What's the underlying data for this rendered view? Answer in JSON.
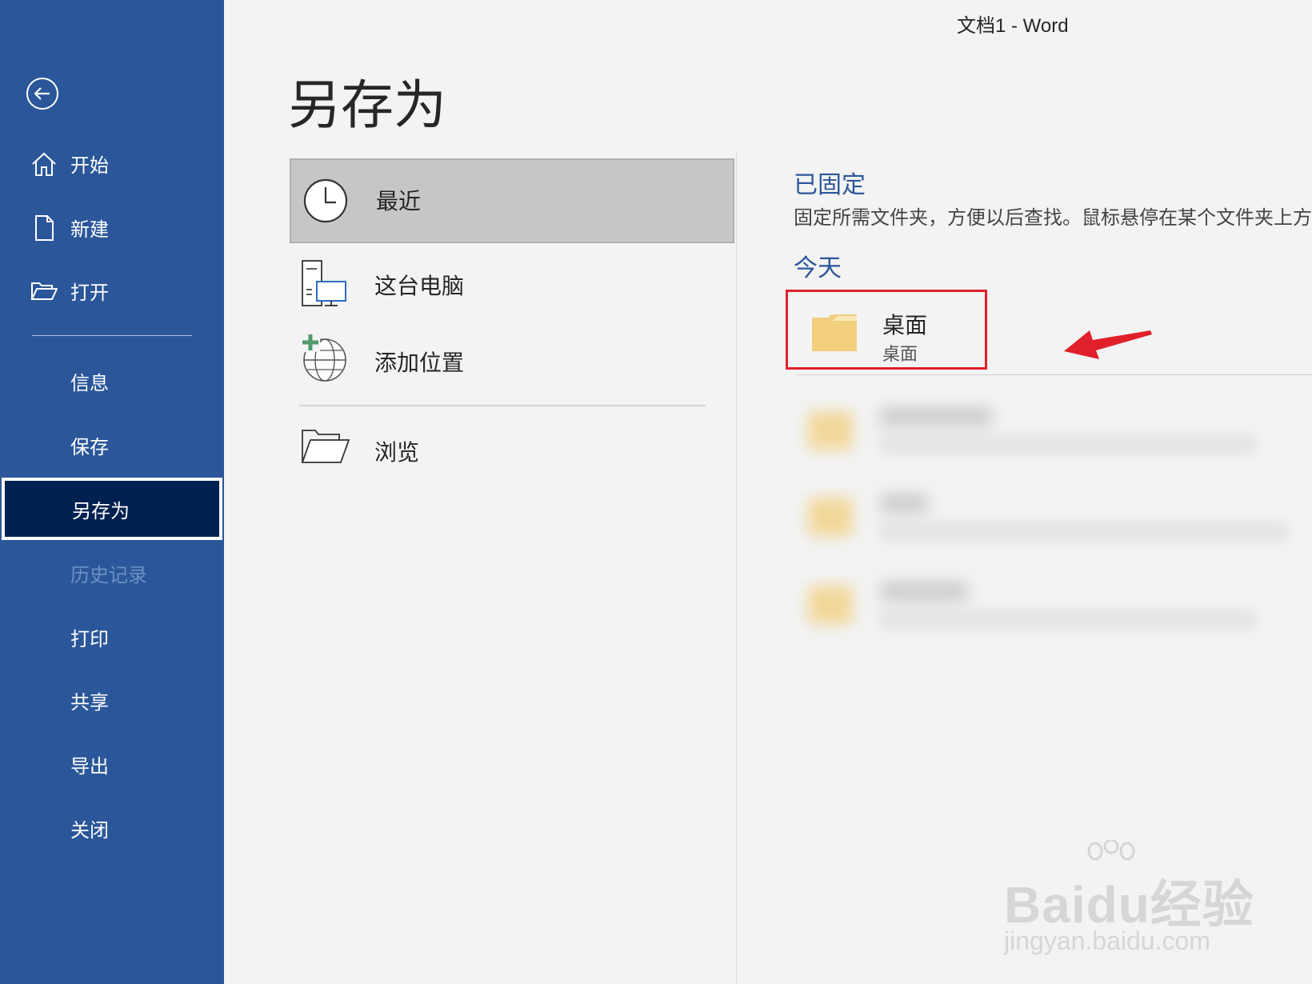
{
  "window": {
    "title": "文档1  -  Word"
  },
  "sidebar": {
    "back_icon": "arrow-left-circle-icon",
    "top_items": [
      {
        "label": "开始",
        "icon": "home-icon"
      },
      {
        "label": "新建",
        "icon": "new-document-icon"
      },
      {
        "label": "打开",
        "icon": "open-folder-icon"
      }
    ],
    "items": [
      {
        "label": "信息"
      },
      {
        "label": "保存"
      },
      {
        "label": "另存为",
        "active": true
      },
      {
        "label": "历史记录",
        "disabled": true
      },
      {
        "label": "打印"
      },
      {
        "label": "共享"
      },
      {
        "label": "导出"
      },
      {
        "label": "关闭"
      }
    ]
  },
  "main": {
    "page_title": "另存为",
    "locations": [
      {
        "label": "最近",
        "icon": "clock-icon",
        "selected": true
      },
      {
        "label": "这台电脑",
        "icon": "computer-icon"
      },
      {
        "label": "添加位置",
        "icon": "add-globe-icon"
      },
      {
        "label": "浏览",
        "icon": "folder-open-icon"
      }
    ]
  },
  "recent": {
    "pinned_heading": "已固定",
    "pinned_description": "固定所需文件夹，方便以后查找。鼠标悬停在某个文件夹上方",
    "today_heading": "今天",
    "folder": {
      "name": "桌面",
      "path": "桌面"
    }
  },
  "watermark": {
    "brand": "Baidu经验",
    "url": "jingyan.baidu.com"
  },
  "colors": {
    "sidebar": "#2b579a",
    "active_nav": "#002050",
    "accent": "#2b579a",
    "highlight_box": "#e0202a"
  }
}
